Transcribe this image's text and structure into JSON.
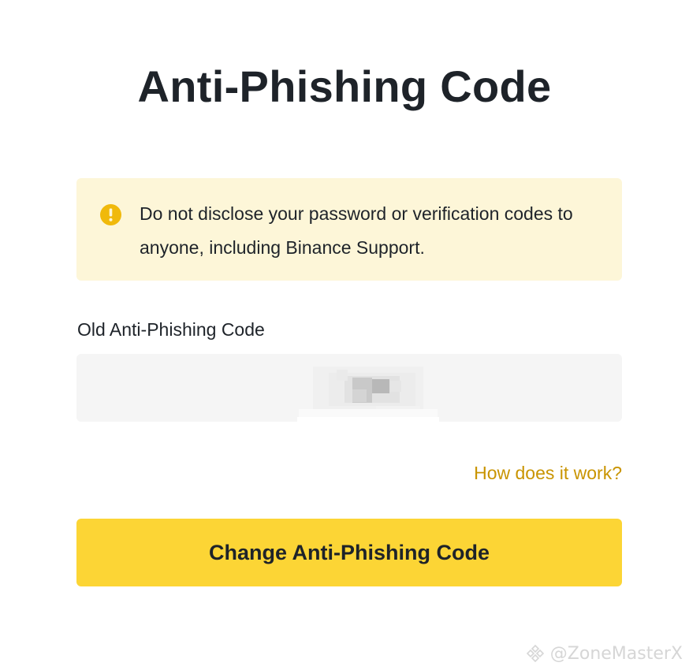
{
  "page": {
    "title": "Anti-Phishing Code"
  },
  "warning": {
    "icon": "exclamation-circle-icon",
    "text": "Do not disclose your password or verification codes to anyone, including Binance Support."
  },
  "form": {
    "old_code_label": "Old Anti-Phishing Code",
    "old_code_value": "",
    "help_link": "How does it work?",
    "submit_label": "Change Anti-Phishing Code"
  },
  "watermark": {
    "icon": "binance-logo-icon",
    "text": "@ZoneMasterX"
  },
  "colors": {
    "accent": "#fcd535",
    "link": "#c99400",
    "warning_bg": "#fdf6d8",
    "warning_icon": "#f0b90b",
    "text": "#1e2329",
    "input_bg": "#f5f5f5"
  }
}
